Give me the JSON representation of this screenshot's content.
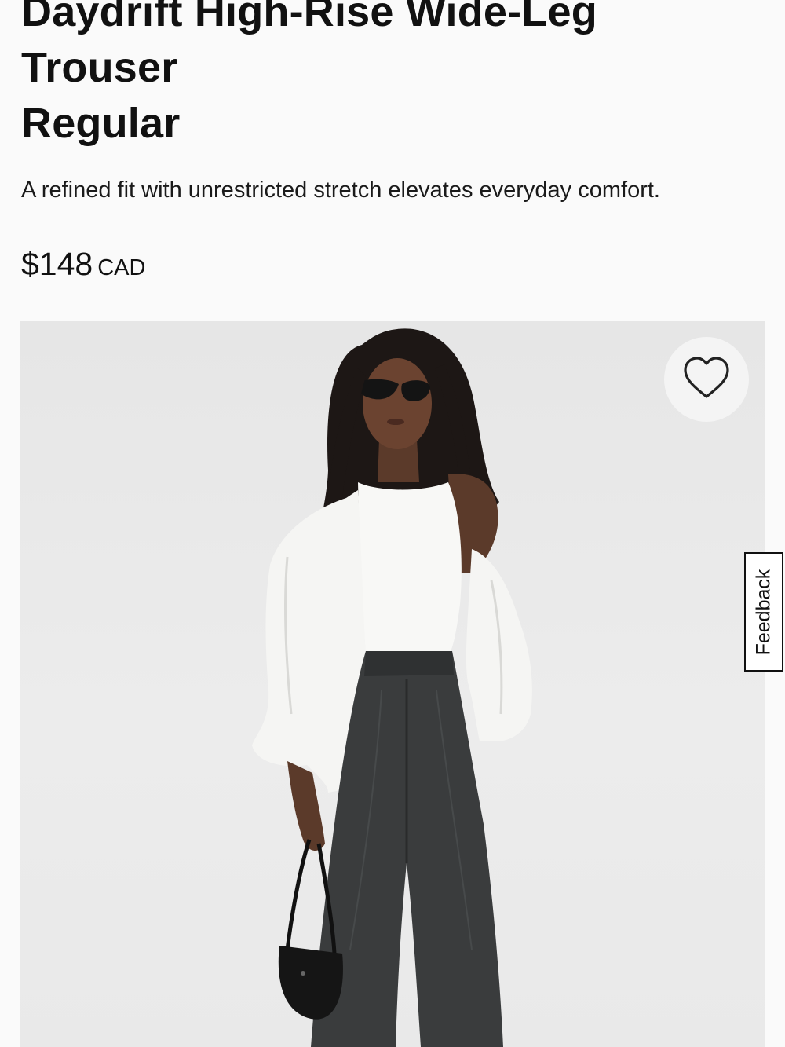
{
  "product": {
    "title_line1": "Daydrift High-Rise Wide-Leg",
    "title_line2": "Trouser",
    "title_line3": "Regular",
    "description": "A refined fit with unrestricted stretch elevates everyday comfort.",
    "price": "$148",
    "currency": "CAD"
  },
  "image": {
    "icon": "heart-icon",
    "wishlist_icon": "heart-outline-icon"
  },
  "feedback": {
    "label": "Feedback"
  },
  "colors": {
    "background": "#fafafa",
    "image_bg": "#e8e8e8",
    "text": "#111111",
    "trouser": "#3a3c3d",
    "shirt": "#f7f7f5"
  }
}
